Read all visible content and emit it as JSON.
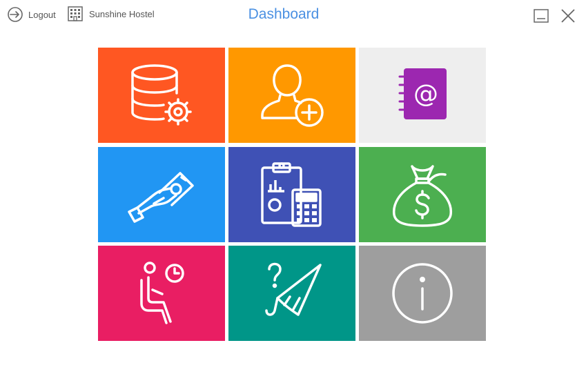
{
  "header": {
    "logout_label": "Logout",
    "hostel_name": "Sunshine Hostel",
    "title": "Dashboard"
  },
  "tiles": [
    {
      "icon": "database-settings-icon",
      "color": "#ff5722"
    },
    {
      "icon": "add-user-icon",
      "color": "#ff9800"
    },
    {
      "icon": "address-book-icon",
      "color": "#eeeeee"
    },
    {
      "icon": "payment-hand-icon",
      "color": "#2196f3"
    },
    {
      "icon": "accounting-calculator-icon",
      "color": "#3f51b5"
    },
    {
      "icon": "money-bag-icon",
      "color": "#4caf50"
    },
    {
      "icon": "waiting-room-icon",
      "color": "#e91e63"
    },
    {
      "icon": "lost-and-found-icon",
      "color": "#009688"
    },
    {
      "icon": "info-icon",
      "color": "#9e9e9e"
    }
  ]
}
